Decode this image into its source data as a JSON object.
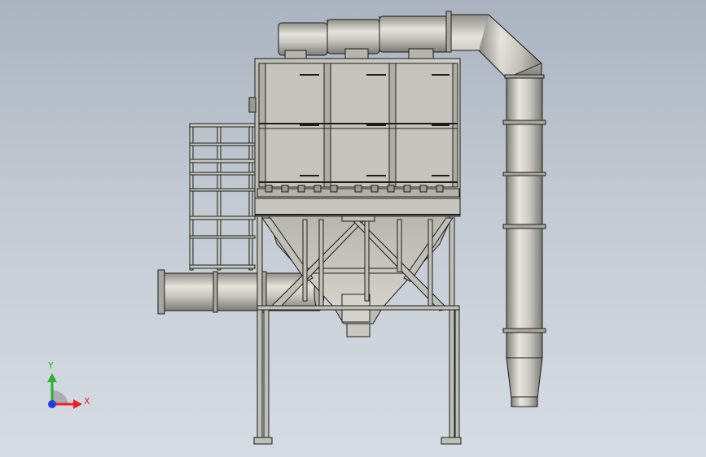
{
  "triad": {
    "x_label": "X",
    "y_label": "Y",
    "x_color": "#e8222a",
    "y_color": "#2fae2f",
    "z_color": "#1f3fe0"
  },
  "colors": {
    "background_top": "#aab3bf",
    "background_bottom": "#d6dce3",
    "steel": "#c9c9c2",
    "edge": "#1c1c1c"
  },
  "components": [
    "top-header-duct",
    "filter-housing",
    "access-ladder",
    "inlet-duct",
    "hopper",
    "support-legs",
    "exhaust-stack"
  ]
}
